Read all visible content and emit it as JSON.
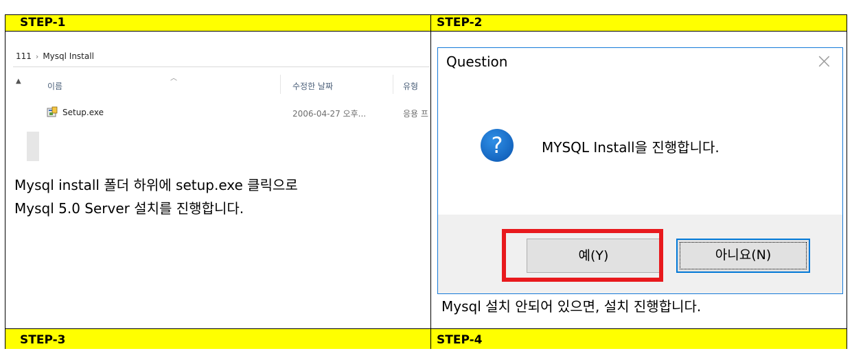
{
  "steps": {
    "step1": "STEP-1",
    "step2": "STEP-2",
    "step3": "STEP-3",
    "step4": "STEP-4"
  },
  "explorer": {
    "breadcrumb_parent": "111",
    "breadcrumb_sep": "›",
    "breadcrumb_current": "Mysql Install",
    "col_name": "이름",
    "col_modified": "수정한 날짜",
    "col_type": "유형",
    "file": {
      "name": "Setup.exe",
      "modified": "2006-04-27 오후...",
      "type": "응용 프"
    }
  },
  "step1_desc": {
    "line1": "Mysql install 폴더 하위에 setup.exe 클릭으로",
    "line2": "Mysql 5.0 Server 설치를 진행합니다."
  },
  "dialog": {
    "title": "Question",
    "close": "×",
    "icon": "question-icon",
    "message": "MYSQL Install을 진행합니다.",
    "yes_label": "예(Y)",
    "no_label": "아니요(N)"
  },
  "step2_desc": "Mysql 설치 안되어 있으면, 설치 진행합니다.",
  "colors": {
    "header_bg": "#ffff00",
    "highlight_border": "#e8191d",
    "focus_border": "#0078d7"
  }
}
